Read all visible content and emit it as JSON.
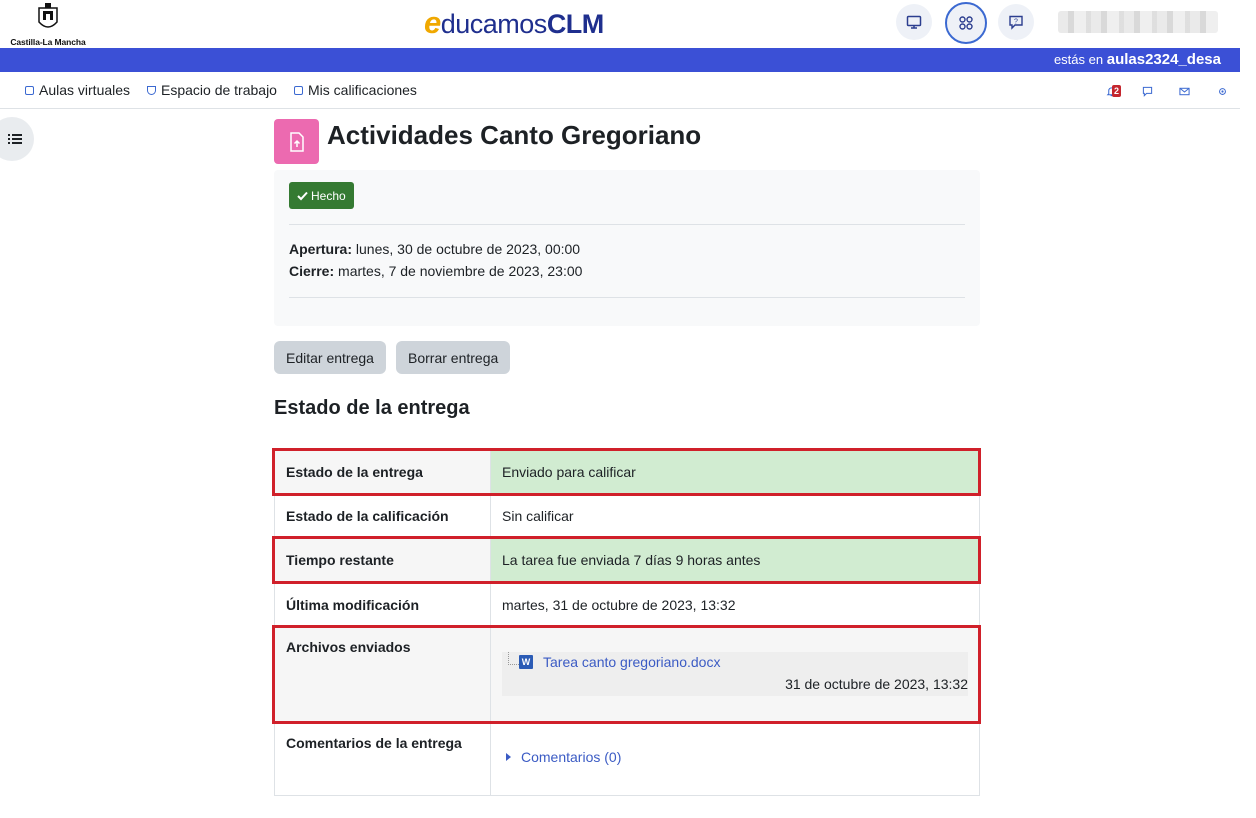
{
  "header": {
    "region_name": "Castilla-La Mancha",
    "brand": {
      "e": "e",
      "rest": "ducamos",
      "clm": "CLM"
    },
    "icons": [
      "monitor-icon",
      "apps-grid-icon",
      "help-chat-icon"
    ],
    "user_name_blurred": true
  },
  "location_bar": {
    "prefix": "estás en",
    "site": "aulas2324_desa"
  },
  "nav": {
    "items": [
      {
        "label": "Aulas virtuales",
        "icon": "aulas-icon"
      },
      {
        "label": "Espacio de trabajo",
        "icon": "workspace-icon"
      },
      {
        "label": "Mis calificaciones",
        "icon": "grades-icon"
      }
    ],
    "notifications_count": "2",
    "right_icons": [
      "bell-icon",
      "messages-icon",
      "mail-icon",
      "settings-icon"
    ]
  },
  "activity": {
    "title": "Actividades Canto Gregoriano",
    "status_badge": "Hecho",
    "opening_label": "Apertura:",
    "opening_value": " lunes, 30 de octubre de 2023, 00:00",
    "closing_label": "Cierre:",
    "closing_value": " martes, 7 de noviembre de 2023, 23:00",
    "buttons": {
      "edit": "Editar entrega",
      "delete": "Borrar entrega"
    }
  },
  "submission": {
    "section_title": "Estado de la entrega",
    "rows": [
      {
        "label": "Estado de la entrega",
        "value": "Enviado para calificar"
      },
      {
        "label": "Estado de la calificación",
        "value": "Sin calificar"
      },
      {
        "label": "Tiempo restante",
        "value": "La tarea fue enviada 7 días 9 horas antes"
      },
      {
        "label": "Última modificación",
        "value": "martes, 31 de octubre de 2023, 13:32"
      },
      {
        "label": "Archivos enviados",
        "file_name": "Tarea canto gregoriano.docx",
        "file_date": "31 de octubre de 2023, 13:32"
      },
      {
        "label": "Comentarios de la entrega",
        "comments_link": "Comentarios (0)"
      }
    ]
  },
  "colors": {
    "blue_bar": "#3b50d6",
    "success_bg": "#d1ecd1",
    "done_badge": "#357a32",
    "highlight_border": "#d0202a",
    "activity_icon": "#ec6ab0",
    "link": "#3b5bc4"
  }
}
